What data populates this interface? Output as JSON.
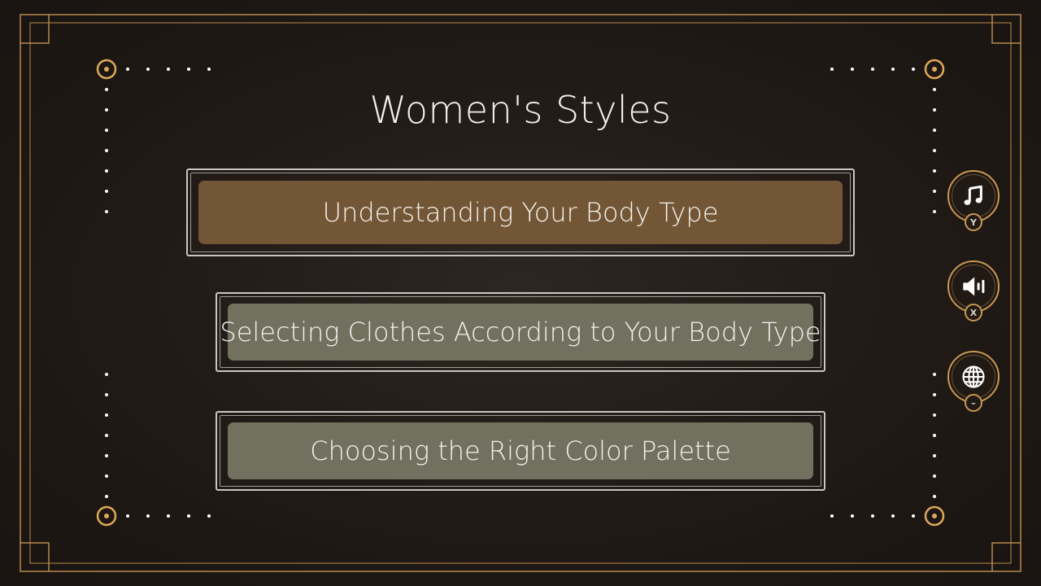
{
  "title": "Women's Styles",
  "menu": {
    "options": [
      {
        "label": "Understanding Your Body Type",
        "selected": true
      },
      {
        "label": "Selecting Clothes According to Your Body Type",
        "selected": false
      },
      {
        "label": "Choosing the Right Color Palette",
        "selected": false
      }
    ]
  },
  "side_buttons": [
    {
      "icon": "music-note-icon",
      "key": "Y"
    },
    {
      "icon": "speaker-icon",
      "key": "X"
    },
    {
      "icon": "globe-icon",
      "key": "–"
    }
  ],
  "colors": {
    "accent": "#c89852",
    "selected_fill": "#725635",
    "option_fill": "#72705f",
    "background": "#221b17"
  }
}
